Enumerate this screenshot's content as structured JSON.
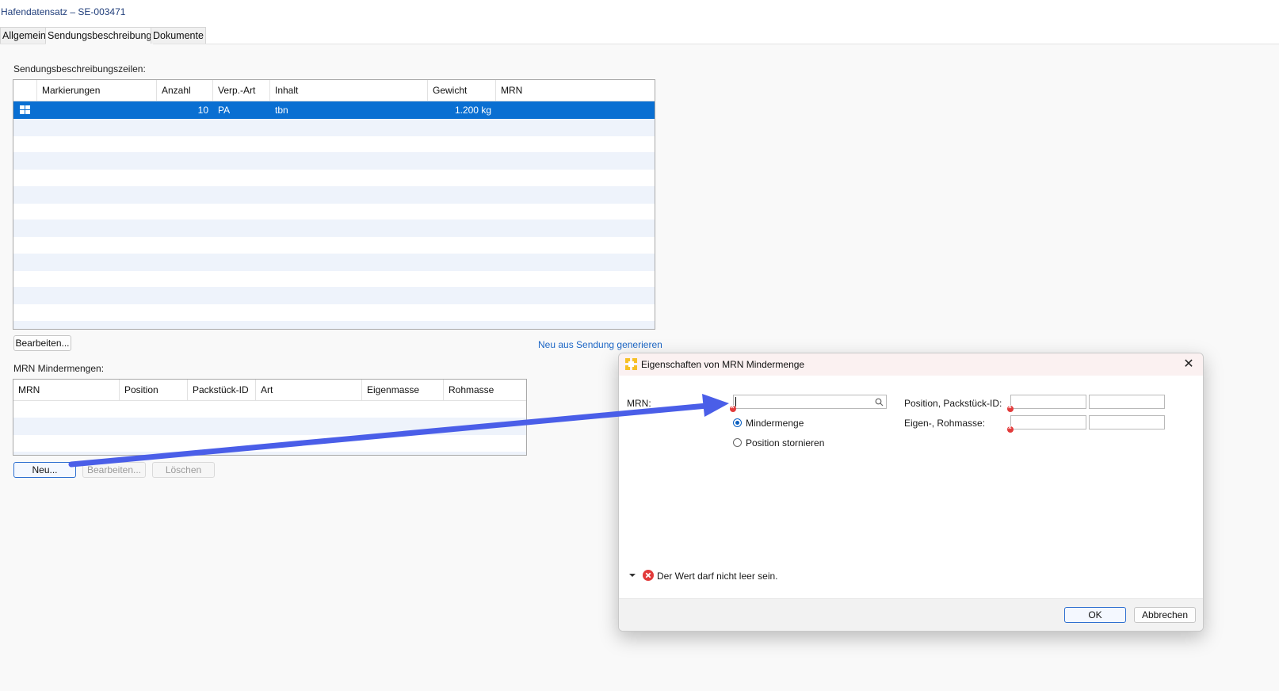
{
  "window": {
    "title": "Hafendatensatz – SE-003471"
  },
  "tabs": [
    {
      "label": "Allgemein"
    },
    {
      "label": "Sendungsbeschreibung"
    },
    {
      "label": "Dokumente"
    }
  ],
  "shipment": {
    "label": "Sendungsbeschreibungszeilen:",
    "columns": [
      "Markierungen",
      "Anzahl",
      "Verp.-Art",
      "Inhalt",
      "Gewicht",
      "MRN"
    ],
    "rows": [
      {
        "markierungen": "",
        "anzahl": "10",
        "verp_art": "PA",
        "inhalt": "tbn",
        "gewicht": "1.200 kg",
        "mrn": ""
      }
    ],
    "edit_button": "Bearbeiten...",
    "generate_link": "Neu aus Sendung generieren"
  },
  "mrn_section": {
    "label": "MRN Mindermengen:",
    "columns": [
      "MRN",
      "Position",
      "Packstück-ID",
      "Art",
      "Eigenmasse",
      "Rohmasse"
    ],
    "buttons": {
      "new": "Neu...",
      "edit": "Bearbeiten...",
      "delete": "Löschen"
    }
  },
  "dialog": {
    "title": "Eigenschaften von MRN Mindermenge",
    "mrn_label": "MRN:",
    "mrn_value": "",
    "radio_mindermenge": "Mindermenge",
    "radio_stornieren": "Position stornieren",
    "position_label": "Position, Packstück-ID:",
    "masse_label": "Eigen-, Rohmasse:",
    "error_message": "Der Wert darf nicht leer sein.",
    "ok": "OK",
    "cancel": "Abbrechen"
  },
  "colors": {
    "selection": "#0a6fd2",
    "accent": "#2d6fd0",
    "error": "#e23b3b",
    "arrow": "#4a5ee8"
  }
}
